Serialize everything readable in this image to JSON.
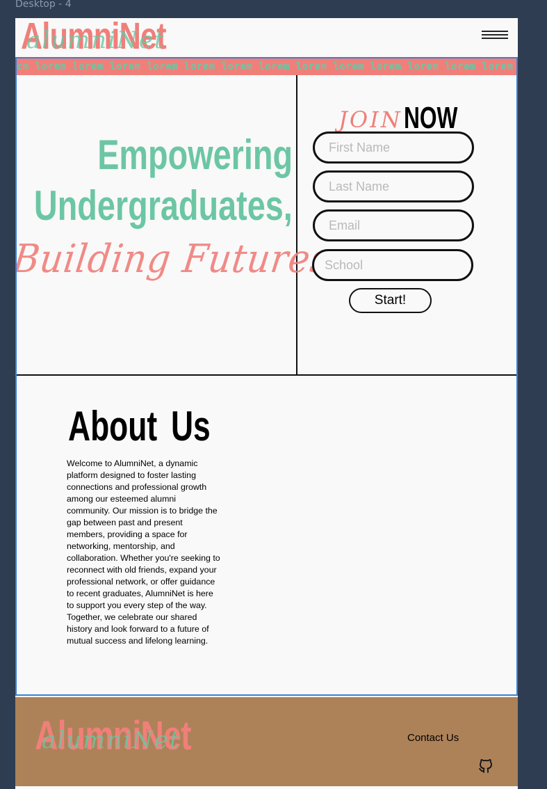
{
  "canvas": {
    "frame_label": "Desktop - 4"
  },
  "header": {
    "logo_text": "AlumniNet",
    "logo_script": "alumniNet",
    "menu_icon": "hamburger-icon"
  },
  "ticker": {
    "text": "cm lorem lorem lorem lorem lorem lorem lorem lorem lorem lorem lorem lorem lorem lorem lorem lorem lorem lorem lorem lo"
  },
  "hero": {
    "line1": "Empowering",
    "line2": "Undergraduates,",
    "script": "Building Futures"
  },
  "join": {
    "script": "JOIN",
    "now": "NOW",
    "first_name_placeholder": "First Name",
    "last_name_placeholder": "Last Name",
    "email_placeholder": "Email",
    "school_placeholder": "School",
    "start_label": "Start!"
  },
  "about": {
    "title": "About Us",
    "body": "Welcome to AlumniNet, a dynamic platform designed to foster lasting connections and professional growth among our esteemed alumni community. Our mission is to bridge the gap between past and present members, providing a space for networking, mentorship, and collaboration. Whether you're seeking to reconnect with old friends, expand your professional network, or offer guidance to recent graduates, AlumniNet is here to support you every step of the way. Together, we celebrate our shared history and look forward to a future of mutual success and lifelong learning."
  },
  "footer": {
    "logo_text": "AlumniNet",
    "logo_script": "alumniNet",
    "contact_label": "Contact Us",
    "github_icon": "github-icon"
  },
  "colors": {
    "coral": "#f07f7a",
    "mint": "#6cc6a4",
    "footer_brown": "#ad8259",
    "canvas_bg": "#2e3d52",
    "selection_blue": "#3b7fd6"
  }
}
